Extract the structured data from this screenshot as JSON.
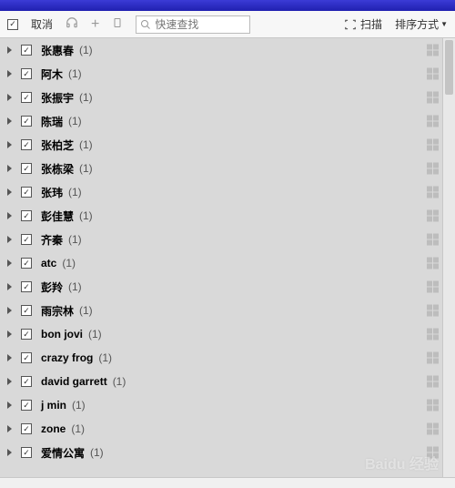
{
  "toolbar": {
    "cancel": "取消",
    "search_placeholder": "快速查找",
    "scan": "扫描",
    "sort": "排序方式"
  },
  "artists": [
    {
      "name": "张惠春",
      "count": "(1)"
    },
    {
      "name": "阿木",
      "count": "(1)"
    },
    {
      "name": "张振宇",
      "count": "(1)"
    },
    {
      "name": "陈瑞",
      "count": "(1)"
    },
    {
      "name": "张柏芝",
      "count": "(1)"
    },
    {
      "name": "张栋梁",
      "count": "(1)"
    },
    {
      "name": "张玮",
      "count": "(1)"
    },
    {
      "name": "彭佳慧",
      "count": "(1)"
    },
    {
      "name": "齐秦",
      "count": "(1)"
    },
    {
      "name": "atc",
      "count": "(1)"
    },
    {
      "name": "彭羚",
      "count": "(1)"
    },
    {
      "name": "雨宗林",
      "count": "(1)"
    },
    {
      "name": "bon jovi",
      "count": "(1)"
    },
    {
      "name": "crazy frog",
      "count": "(1)"
    },
    {
      "name": "david garrett",
      "count": "(1)"
    },
    {
      "name": "j min",
      "count": "(1)"
    },
    {
      "name": "zone",
      "count": "(1)"
    },
    {
      "name": "爱情公寓",
      "count": "(1)"
    }
  ],
  "watermark": "Baidu 经验"
}
